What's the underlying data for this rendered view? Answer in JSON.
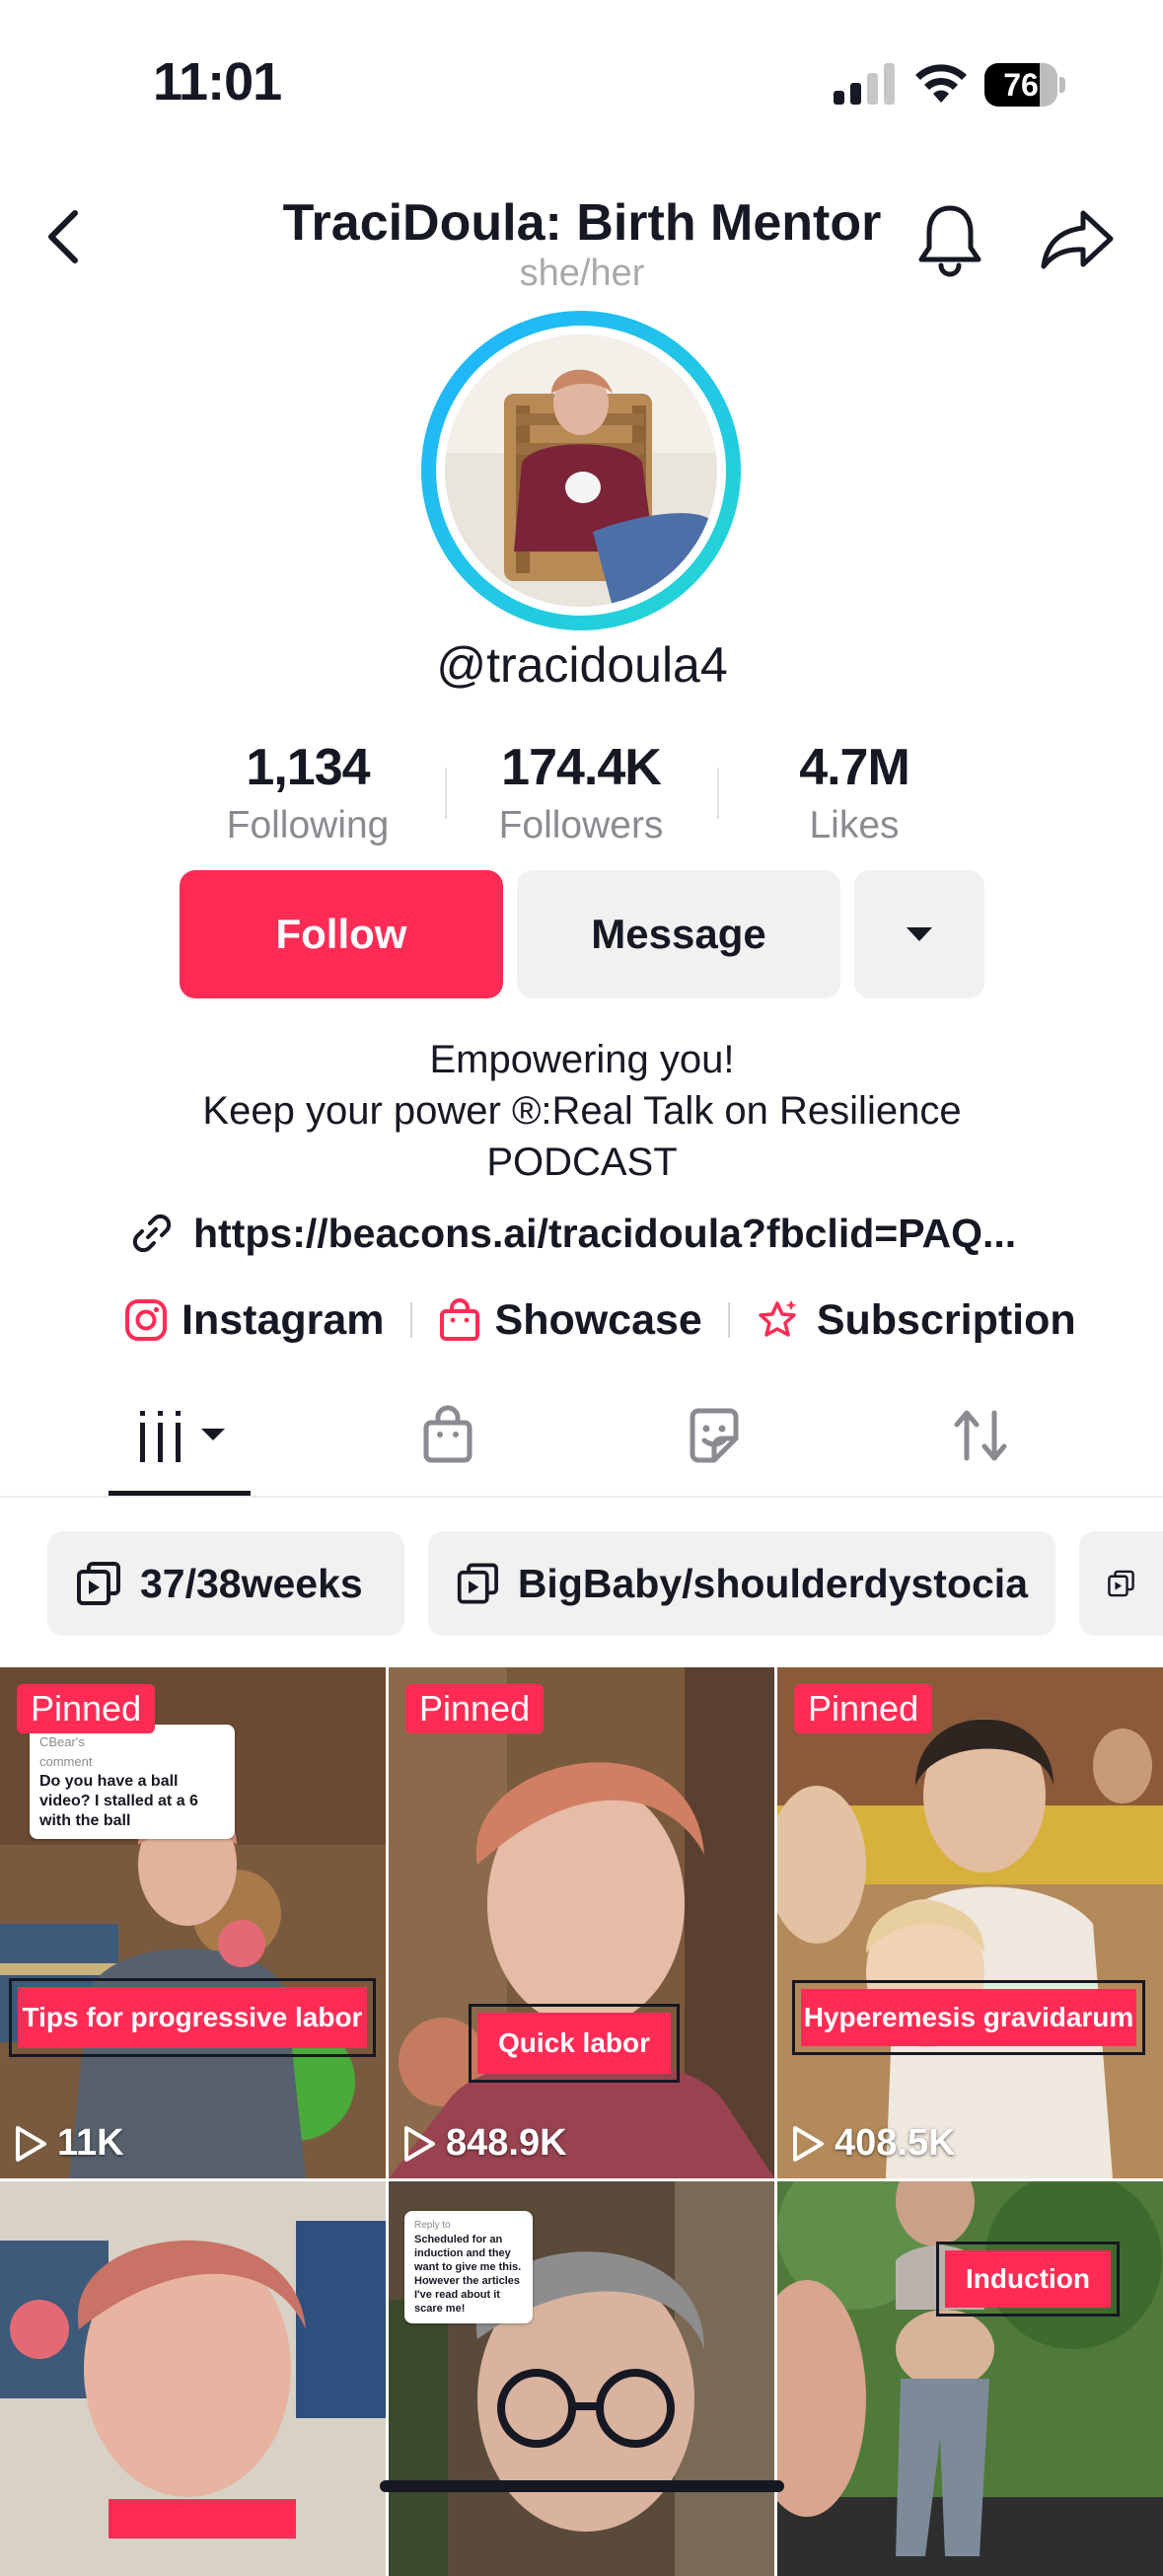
{
  "status_bar": {
    "time": "11:01",
    "battery": "76",
    "battery_level": 0.76
  },
  "header": {
    "title": "TraciDoula: Birth Mentor",
    "pronouns": "she/her"
  },
  "profile": {
    "handle": "@tracidoula4",
    "stats": [
      {
        "value": "1,134",
        "label": "Following"
      },
      {
        "value": "174.4K",
        "label": "Followers"
      },
      {
        "value": "4.7M",
        "label": "Likes"
      }
    ],
    "buttons": {
      "follow": "Follow",
      "message": "Message"
    },
    "bio": [
      "Empowering you!",
      "Keep your power ®:Real Talk on Resilience",
      "PODCAST"
    ],
    "link": "https://beacons.ai/tracidoula?fbclid=PAQ...",
    "socials": [
      "Instagram",
      "Showcase",
      "Subscription"
    ]
  },
  "playlists": [
    "37/38weeks",
    "BigBaby/shoulderdystocia"
  ],
  "videos": [
    {
      "pinned": "Pinned",
      "caption": "Tips for progressive labor",
      "views": "11K",
      "comment": "Do you have a ball video? I stalled at a 6 with the ball",
      "comment_head": "comment",
      "comment_author": "CBear's"
    },
    {
      "pinned": "Pinned",
      "caption": "Quick labor",
      "views": "848.9K"
    },
    {
      "pinned": "Pinned",
      "caption": "Hyperemesis gravidarum",
      "views": "408.5K"
    },
    {
      "caption": ""
    },
    {
      "comment": "Scheduled for an induction and they want to give me this. However the articles I've read about it scare me!",
      "comment_head": "Reply to"
    },
    {
      "caption": "Induction"
    }
  ],
  "colors": {
    "accent": "#fe2c55",
    "text": "#161823",
    "muted": "#8a8b91",
    "chip": "#f1f1f2"
  }
}
